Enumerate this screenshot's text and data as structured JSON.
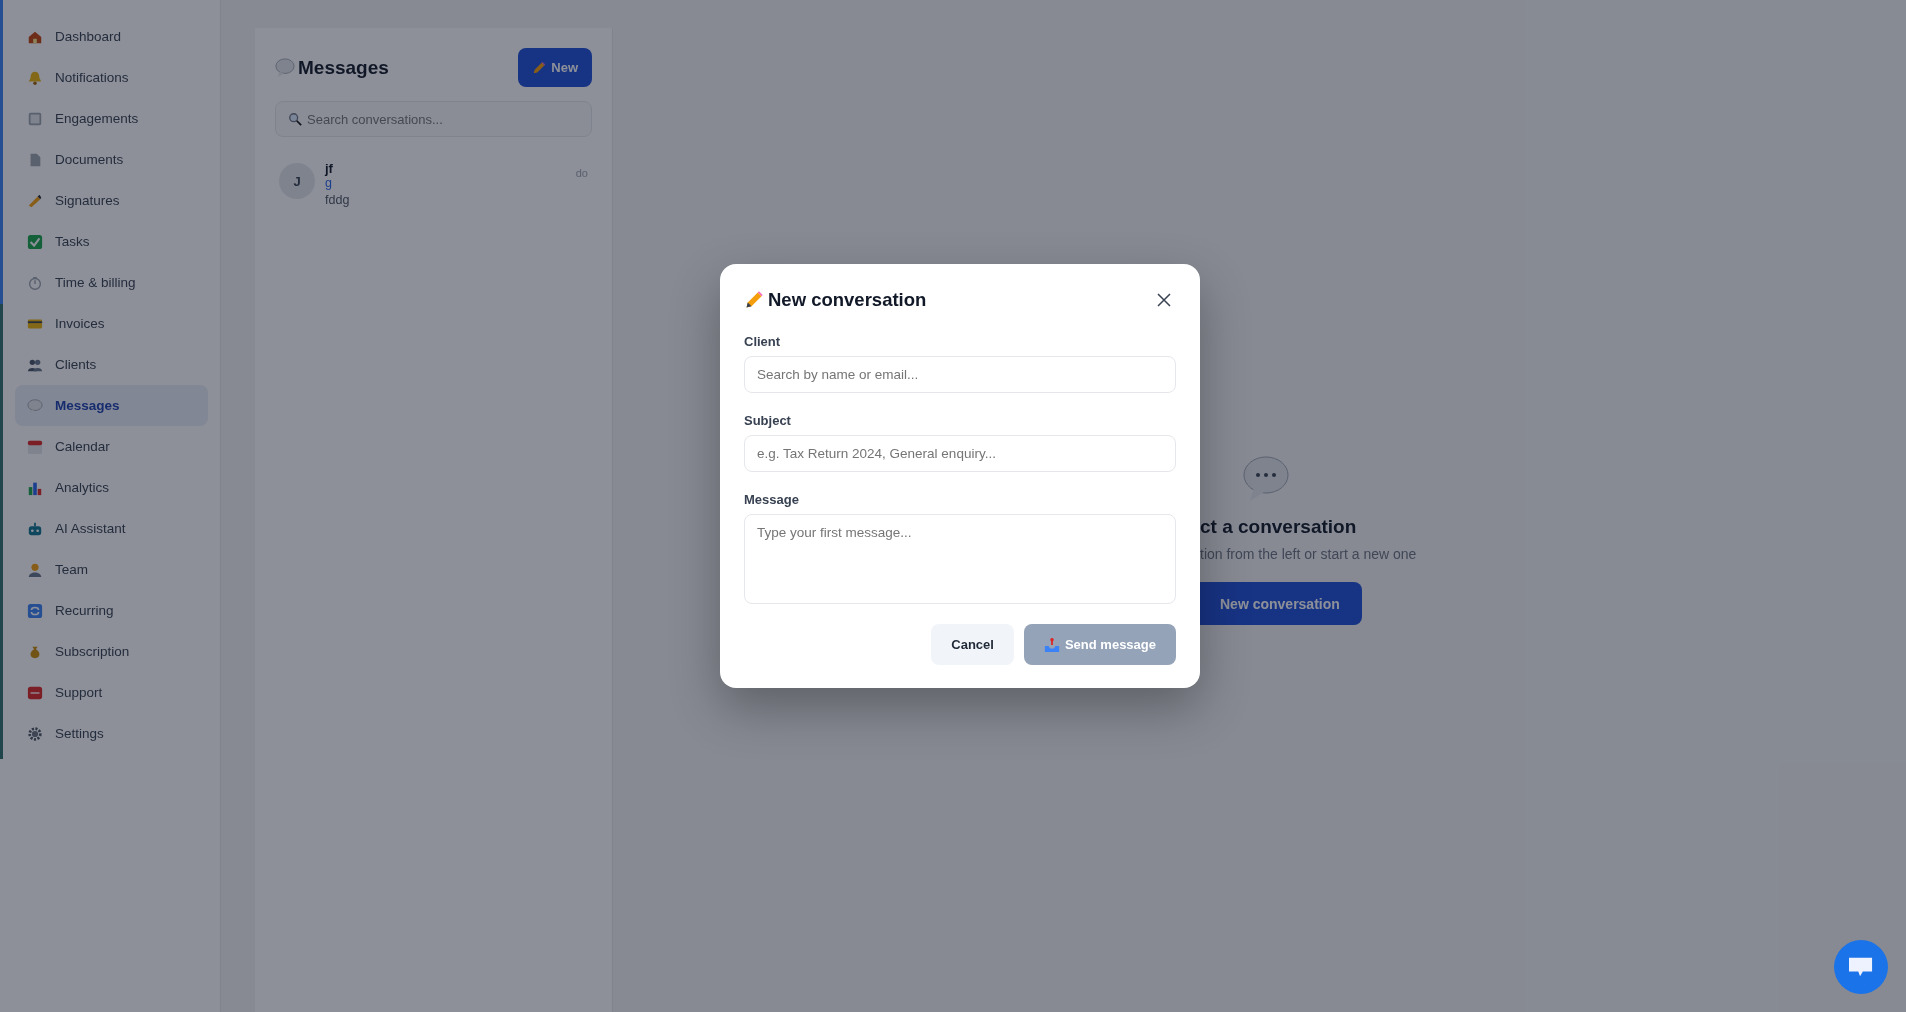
{
  "sidebar": {
    "items": [
      {
        "label": "Dashboard",
        "selected": false
      },
      {
        "label": "Notifications",
        "selected": false
      },
      {
        "label": "Engagements",
        "selected": false
      },
      {
        "label": "Documents",
        "selected": false
      },
      {
        "label": "Signatures",
        "selected": false
      },
      {
        "label": "Tasks",
        "selected": false
      },
      {
        "label": "Time & billing",
        "selected": false
      },
      {
        "label": "Invoices",
        "selected": false
      },
      {
        "label": "Clients",
        "selected": false
      },
      {
        "label": "Messages",
        "selected": true
      },
      {
        "label": "Calendar",
        "selected": false
      },
      {
        "label": "Analytics",
        "selected": false
      },
      {
        "label": "AI Assistant",
        "selected": false
      },
      {
        "label": "Team",
        "selected": false
      },
      {
        "label": "Recurring",
        "selected": false
      },
      {
        "label": "Subscription",
        "selected": false
      },
      {
        "label": "Support",
        "selected": false
      },
      {
        "label": "Settings",
        "selected": false
      }
    ]
  },
  "messages_panel": {
    "title": "Messages",
    "new_button": "New",
    "search": {
      "placeholder": "Search conversations..."
    },
    "conversations": [
      {
        "avatar": "J",
        "name": "jf",
        "subject": "g",
        "preview": "fddg",
        "time": "do",
        "selected": false
      }
    ]
  },
  "empty_state": {
    "title": "ct a conversation",
    "subtitle": "tion from the left or start a new one",
    "button": "New conversation"
  },
  "modal": {
    "title": "New conversation",
    "fields": [
      {
        "kind": "input",
        "label": "Client",
        "placeholder": "Search by name or email..."
      },
      {
        "kind": "input",
        "label": "Subject",
        "placeholder": "e.g. Tax Return 2024, General enquiry..."
      },
      {
        "kind": "textarea",
        "label": "Message",
        "placeholder": "Type your first message..."
      }
    ],
    "cancel_button": "Cancel",
    "send_button": {
      "label": "Send message",
      "disabled": true
    }
  }
}
